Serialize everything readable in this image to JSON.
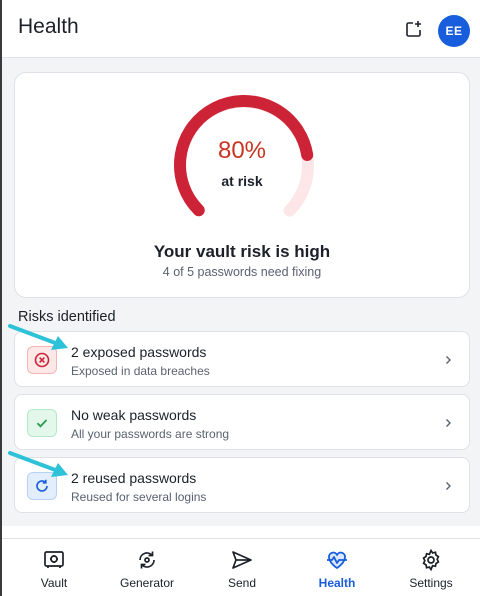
{
  "header": {
    "title": "Health",
    "avatar_initials": "EE",
    "new_tab_icon": "external-link-icon"
  },
  "risk_summary": {
    "percent_label": "80%",
    "percent_value": 80,
    "at_risk_label": "at risk",
    "title": "Your vault risk is high",
    "subtitle": "4 of 5 passwords need fixing"
  },
  "risks": {
    "section_title": "Risks identified",
    "items": [
      {
        "title": "2 exposed passwords",
        "subtitle": "Exposed in data breaches",
        "icon": "x-circle-icon",
        "status": "danger"
      },
      {
        "title": "No weak passwords",
        "subtitle": "All your passwords are strong",
        "icon": "check-icon",
        "status": "success"
      },
      {
        "title": "2 reused passwords",
        "subtitle": "Reused for several logins",
        "icon": "refresh-icon",
        "status": "info"
      }
    ]
  },
  "nav": {
    "tabs": [
      {
        "label": "Vault",
        "icon": "vault-icon",
        "active": false
      },
      {
        "label": "Generator",
        "icon": "generator-icon",
        "active": false
      },
      {
        "label": "Send",
        "icon": "send-icon",
        "active": false
      },
      {
        "label": "Health",
        "icon": "health-icon",
        "active": true
      },
      {
        "label": "Settings",
        "icon": "settings-gear-icon",
        "active": false
      }
    ]
  },
  "colors": {
    "accent": "#175ddc",
    "danger": "#cc2436",
    "danger_light": "#fde6e8",
    "success": "#2c9b51",
    "arrow": "#2ec2d9"
  }
}
